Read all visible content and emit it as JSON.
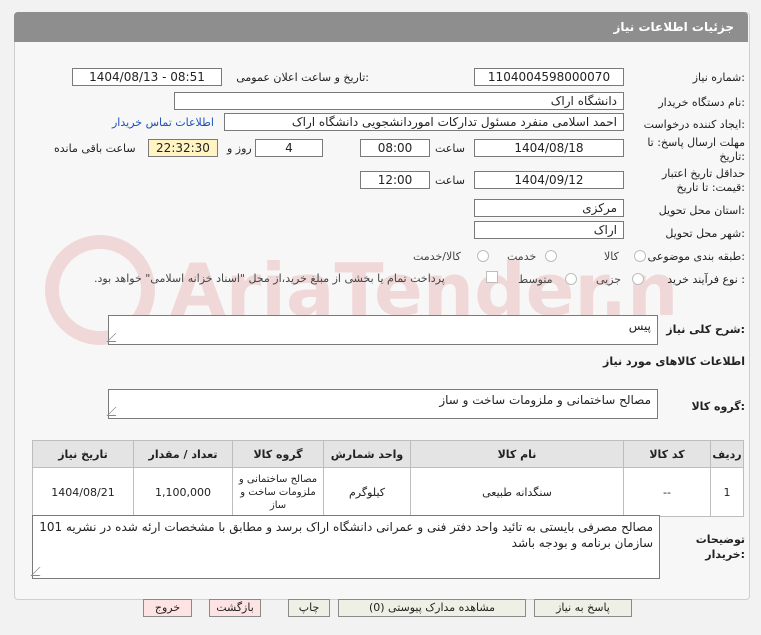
{
  "header": {
    "title": "جزئیات اطلاعات نیاز"
  },
  "fields": {
    "need_number_label": "شماره نیاز:",
    "need_number": "1104004598000070",
    "announce_label": "تاریخ و ساعت اعلان عمومی:",
    "announce_value": "1404/08/13 - 08:51",
    "buyer_label": "نام دستگاه خریدار:",
    "buyer_value": "دانشگاه اراک",
    "creator_label": "ایجاد کننده درخواست:",
    "creator_value": "احمد  اسلامی منفرد مسئول تدارکات اموردانشجویی دانشگاه اراک",
    "contact_link": "اطلاعات تماس خریدار",
    "deadline_label": "مهلت ارسال پاسخ: تا تاریخ:",
    "deadline_date": "1404/08/18",
    "time_label": "ساعت",
    "deadline_time": "08:00",
    "days_value": "4",
    "days_label": "روز و",
    "remaining_time": "22:32:30",
    "remaining_label": "ساعت باقی مانده",
    "validity_label": "حداقل تاریخ اعتبار قیمت: تا تاریخ:",
    "validity_date": "1404/09/12",
    "validity_time": "12:00",
    "province_label": "استان محل تحویل:",
    "province_value": "مرکزی",
    "city_label": "شهر محل تحویل:",
    "city_value": "اراک",
    "category_label": "طبقه بندی موضوعی:",
    "category_options": [
      "کالا",
      "خدمت",
      "کالا/خدمت"
    ],
    "process_label": "نوع فرآیند خرید :",
    "process_options": [
      "جزیی",
      "متوسط"
    ],
    "process_note": "پرداخت تمام یا بخشی از مبلغ خرید،از محل \"اسناد خزانه اسلامی\" خواهد بود."
  },
  "summary": {
    "label": "شرح کلی نیاز:",
    "value": "پیس"
  },
  "goods": {
    "section_title": "اطلاعات کالاهای مورد نیاز",
    "group_label": "گروه کالا:",
    "group_value": "مصالح ساختمانی و ملزومات ساخت و ساز",
    "columns": [
      "ردیف",
      "کد کالا",
      "نام کالا",
      "واحد شمارش",
      "گروه کالا",
      "تعداد / مقدار",
      "تاریخ نیاز"
    ],
    "rows": [
      [
        "1",
        "--",
        "سنگدانه طبیعی",
        "کیلوگرم",
        "مصالح ساختمانی و ملزومات ساخت و ساز",
        "1,100,000",
        "1404/08/21"
      ]
    ]
  },
  "notes": {
    "label": "توضیحات خریدار:",
    "value": "مصالح مصرفی بایستی به تائید واحد دفتر فنی و عمرانی دانشگاه اراک برسد و مطابق با مشخصات ارئه شده در نشریه 101 سازمان برنامه و بودجه باشد"
  },
  "buttons": {
    "reply": "پاسخ به نیاز",
    "attachments": "مشاهده مدارک پیوستی (0)",
    "print": "چاپ",
    "back": "بازگشت",
    "exit": "خروج"
  },
  "watermark": {
    "text": "AriaTender.net"
  }
}
